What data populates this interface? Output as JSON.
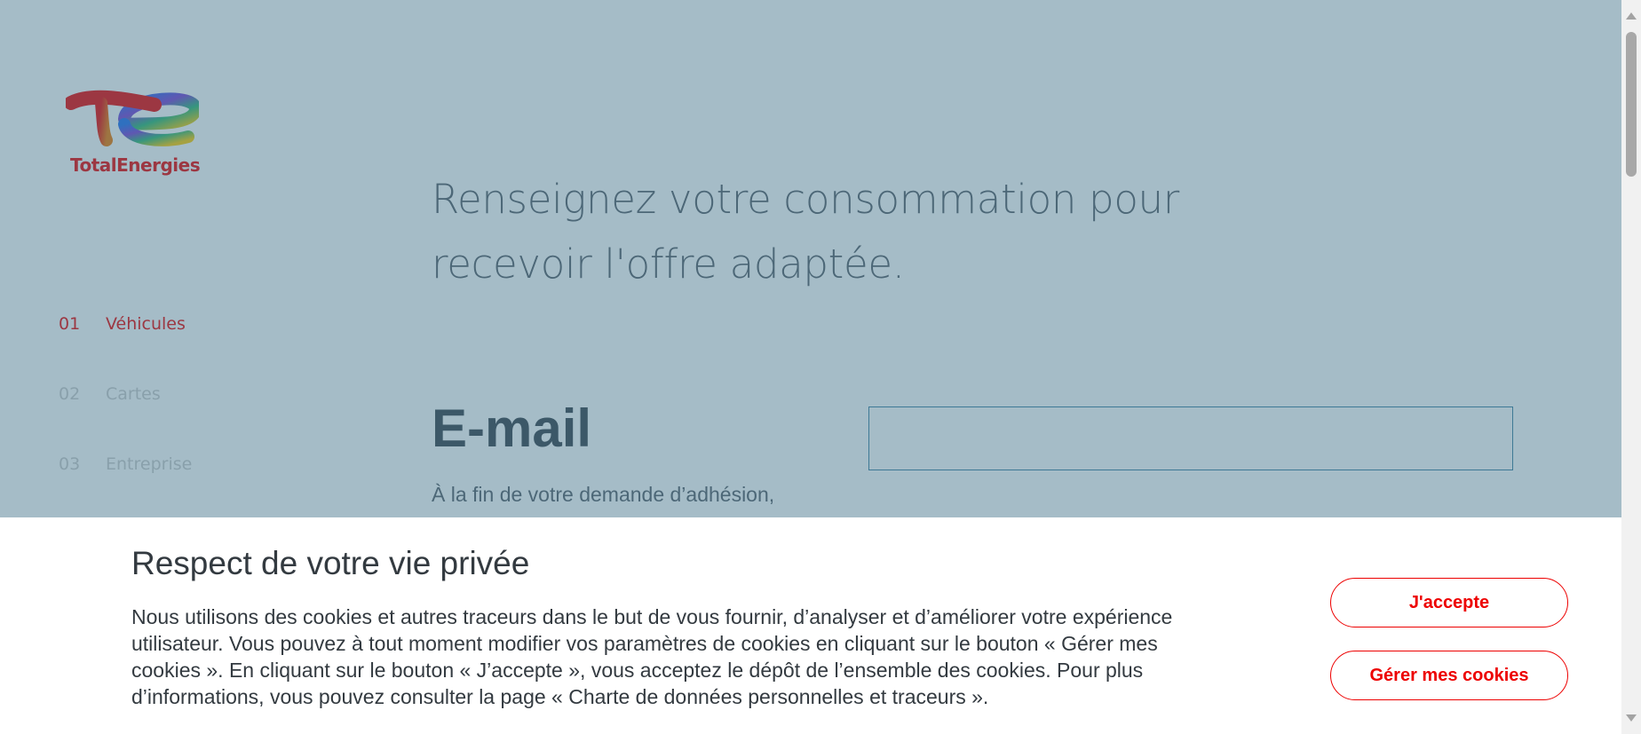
{
  "brand": {
    "name": "TotalEnergies",
    "color": "#ED0000"
  },
  "steps": [
    {
      "num": "01",
      "label": "Véhicules",
      "state": "active"
    },
    {
      "num": "02",
      "label": "Cartes",
      "state": "inactive"
    },
    {
      "num": "03",
      "label": "Entreprise",
      "state": "inactive"
    }
  ],
  "main": {
    "headline": "Renseignez votre consommation pour recevoir l'offre adaptée.",
    "email": {
      "label": "E-mail",
      "help": "À la fin de votre demande d’adhésion,",
      "value": "",
      "placeholder": ""
    }
  },
  "cookie_banner": {
    "title": "Respect de votre vie privée",
    "text": "Nous utilisons des cookies et autres traceurs dans le but de vous fournir, d’analyser et d’améliorer votre expérience utilisateur. Vous pouvez à tout moment modifier vos paramètres de cookies en cliquant sur le bouton « Gérer mes cookies ». En cliquant sur le bouton « J’accepte », vous acceptez le dépôt de l’ensemble des cookies. Pour plus d’informations, vous pouvez consulter la page « Charte de données personnelles et traceurs ».",
    "accept_label": "J'accepte",
    "manage_label": "Gérer mes cookies"
  },
  "colors": {
    "overlay": "#43748a",
    "text_dark": "#333a40",
    "inactive": "#c9c9c9"
  }
}
